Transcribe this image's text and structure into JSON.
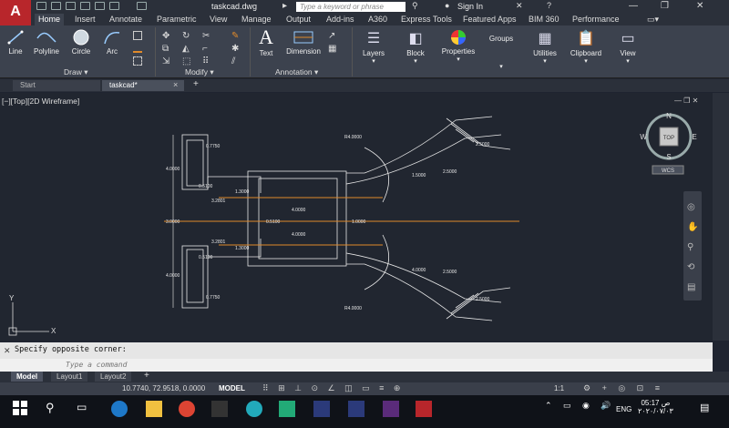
{
  "app": {
    "logo": "A",
    "document_title": "taskcad.dwg",
    "search_placeholder": "Type a keyword or phrase",
    "sign_in": "Sign In"
  },
  "ribbon_tabs": [
    "Home",
    "Insert",
    "Annotate",
    "Parametric",
    "View",
    "Manage",
    "Output",
    "Add-ins",
    "A360",
    "Express Tools",
    "Featured Apps",
    "BIM 360",
    "Performance"
  ],
  "ribbon": {
    "draw": {
      "line": "Line",
      "polyline": "Polyline",
      "circle": "Circle",
      "arc": "Arc",
      "panel": "Draw"
    },
    "modify": {
      "panel": "Modify"
    },
    "annotation": {
      "text": "Text",
      "dimension": "Dimension",
      "panel": "Annotation"
    },
    "layers": "Layers",
    "block": "Block",
    "properties": "Properties",
    "groups": "Groups",
    "utilities": "Utilities",
    "clipboard": "Clipboard",
    "view": "View"
  },
  "file_tabs": [
    "Start",
    "taskcad*"
  ],
  "viewport": {
    "label": "[−][Top][2D Wireframe]",
    "viewcube": {
      "n": "N",
      "s": "S",
      "e": "E",
      "w": "W",
      "top": "TOP",
      "wcs": "WCS"
    }
  },
  "drawing_labels": {
    "dim_top_left": "0.7750",
    "dim_left_upper": "4.0000",
    "dim_mid_left": "3.0000",
    "dim_left_lower": "4.0000",
    "dim_bottom_left": "0.7750",
    "small_upper_1": "0.5100",
    "small_upper_2": "1.3000",
    "small_upper_3": "3.2801",
    "small_lower_1": "3.2801",
    "small_lower_2": "1.3000",
    "small_lower_3": "0.5100",
    "center_1": "4.0000",
    "center_2": "0.5100",
    "center_3": "1.0000",
    "center_4": "4.0000",
    "r_top": "R4.0000",
    "r_bottom": "R4.0000",
    "arm_up_1": "1.5000",
    "arm_up_2": "2.5000",
    "arm_up_3": "2.5000",
    "arm_dn_1": "4.0000",
    "arm_dn_2": "2.5000",
    "arm_dn_3": "2.5000"
  },
  "command": {
    "history": "Specify opposite corner:",
    "placeholder": "Type a command"
  },
  "layout_tabs": [
    "Model",
    "Layout1",
    "Layout2"
  ],
  "status": {
    "coords": "10.7740, 72.9518, 0.0000",
    "model": "MODEL",
    "scale": "1:1"
  },
  "taskbar": {
    "lang": "ENG",
    "time": "05:17 ص",
    "date": "٢٠٢٠/٠٧/٠٣"
  },
  "colors": {
    "accent_red": "#b8262b",
    "orange_line": "#e08a2a"
  }
}
